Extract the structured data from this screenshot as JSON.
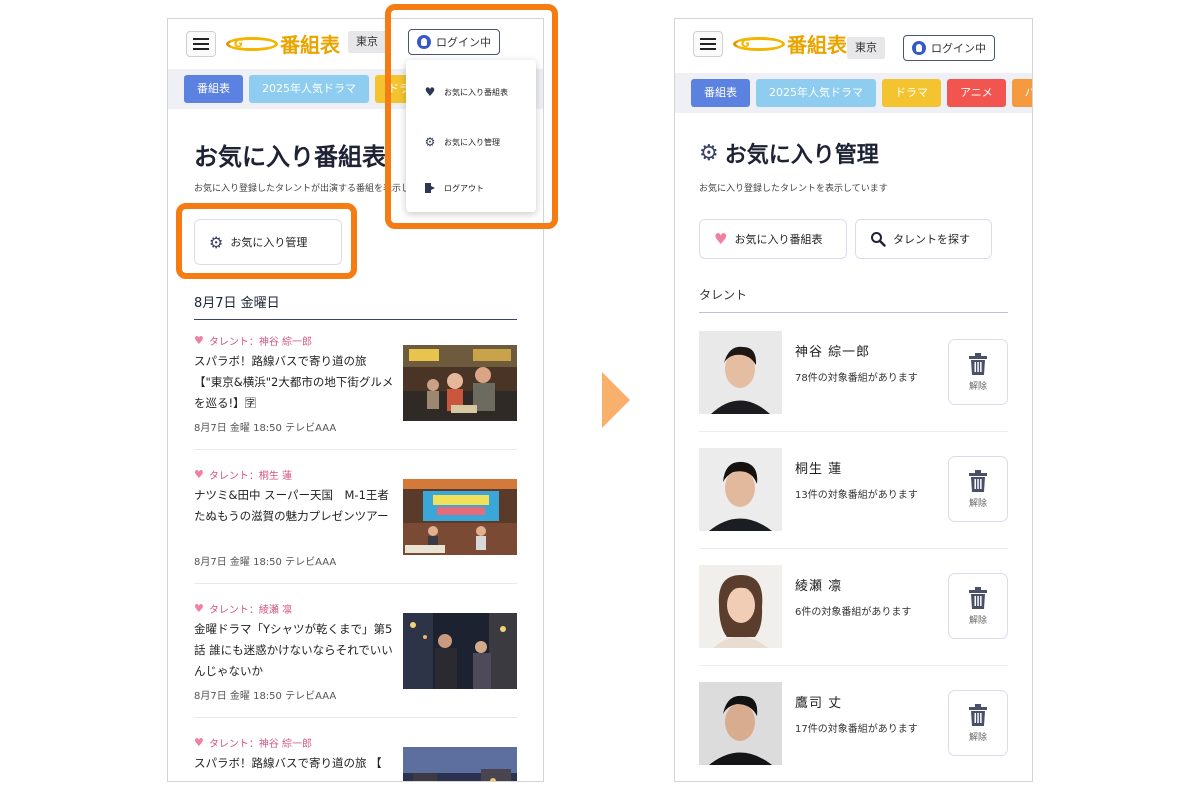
{
  "header": {
    "region": "東京",
    "login_label": "ログイン中",
    "logo_text": "番組表",
    "logo_mark_text": "G"
  },
  "tabs": [
    {
      "label": "番組表",
      "color": "#5b82e0"
    },
    {
      "label": "2025年人気ドラマ",
      "color": "#8ecdf0"
    },
    {
      "label": "ドラマ",
      "color": "#f4c430"
    },
    {
      "label": "アニメ",
      "color": "#f2554f"
    },
    {
      "label": "バラエティ",
      "color": "#f59a3e"
    }
  ],
  "left": {
    "title": "お気に入り番組表",
    "subtitle": "お気に入り登録したタレントが出演する番組を表示しています",
    "manage_button": "お気に入り管理",
    "date_heading": "8月7日 金曜日",
    "programs": [
      {
        "talent": "タレント：神谷 綜一郎",
        "title": "スパラボ！路線バスで寄り道の旅 【\"東京&横浜\"2大都市の地下街グルメを巡る!】🈑",
        "meta": "8月7日 金曜 18:50 テレビAAA"
      },
      {
        "talent": "タレント：桐生 蓮",
        "title": "ナツミ&田中 スーパー天国　M-1王者たぬもうの滋賀の魅力プレゼンツアー",
        "meta": "8月7日 金曜 18:50 テレビAAA"
      },
      {
        "talent": "タレント：綾瀬 凛",
        "title": "金曜ドラマ「Yシャツが乾くまで」第5話 誰にも迷惑かけないならそれでいいんじゃないか",
        "meta": "8月7日 金曜 18:50 テレビAAA"
      },
      {
        "talent": "タレント：神谷 綜一郎",
        "title": "スパラボ！路線バスで寄り道の旅 【",
        "meta": ""
      }
    ]
  },
  "dropdown": {
    "items": [
      {
        "label": "お気に入り番組表",
        "icon": "heart-icon"
      },
      {
        "label": "お気に入り管理",
        "icon": "gear-icon"
      },
      {
        "label": "ログアウト",
        "icon": "logout-icon"
      }
    ]
  },
  "right": {
    "title": "お気に入り管理",
    "subtitle": "お気に入り登録したタレントを表示しています",
    "favorites_button": "お気に入り番組表",
    "search_button": "タレントを探す",
    "section_heading": "タレント",
    "delete_label": "解除",
    "talents": [
      {
        "name": "神谷 綜一郎",
        "count": "78件の対象番組があります"
      },
      {
        "name": "桐生 蓮",
        "count": "13件の対象番組があります"
      },
      {
        "name": "綾瀬 凛",
        "count": "6件の対象番組があります"
      },
      {
        "name": "鷹司 丈",
        "count": "17件の対象番組があります"
      }
    ]
  },
  "colors": {
    "accent_orange": "#f57c12",
    "heart_pink": "#f07fa0",
    "title_navy": "#1e2235"
  }
}
